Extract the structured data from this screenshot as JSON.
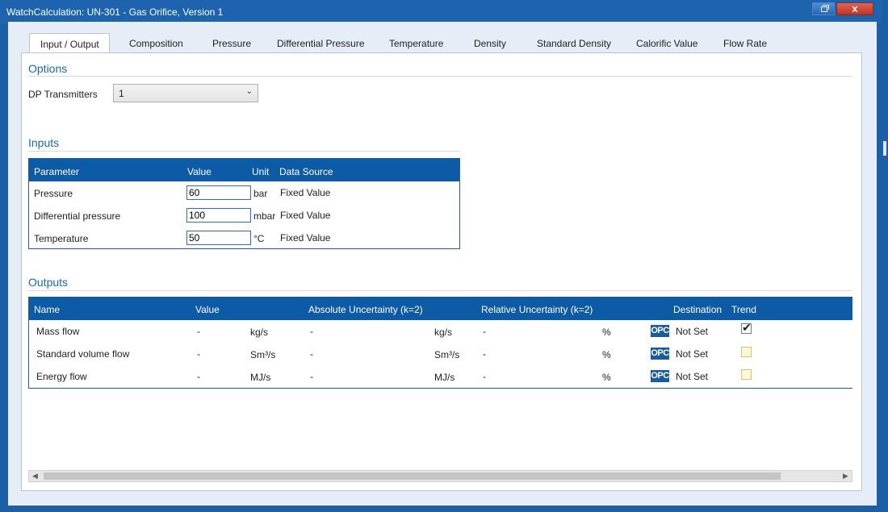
{
  "window": {
    "title": "WatchCalculation: UN-301 - Gas Orifice, Version 1",
    "close_label": "x"
  },
  "tabs": [
    "Input / Output",
    "Composition",
    "Pressure",
    "Differential Pressure",
    "Temperature",
    "Density",
    "Standard Density",
    "Calorific Value",
    "Flow Rate"
  ],
  "active_tab": "Input / Output",
  "options": {
    "title": "Options",
    "dp_label": "DP Transmitters",
    "dp_value": "1"
  },
  "inputs": {
    "title": "Inputs",
    "headers": {
      "parameter": "Parameter",
      "value": "Value",
      "unit": "Unit",
      "source": "Data Source"
    },
    "rows": [
      {
        "parameter": "Pressure",
        "value": "60",
        "unit": "bar",
        "source": "Fixed Value"
      },
      {
        "parameter": "Differential pressure",
        "value": "100",
        "unit": "mbar",
        "source": "Fixed Value"
      },
      {
        "parameter": "Temperature",
        "value": "50",
        "unit": "°C",
        "source": "Fixed Value"
      }
    ]
  },
  "outputs": {
    "title": "Outputs",
    "headers": {
      "name": "Name",
      "value": "Value",
      "abs": "Absolute Uncertainty (k=2)",
      "rel": "Relative Uncertainty (k=2)",
      "dest": "Destination",
      "trend": "Trend"
    },
    "rows": [
      {
        "name": "Mass flow",
        "value": "-",
        "unit": "kg/s",
        "abs": "-",
        "abs_unit": "kg/s",
        "rel": "-",
        "rel_unit": "%",
        "opc": "OPC",
        "dest": "Not Set",
        "trend": true
      },
      {
        "name": "Standard volume flow",
        "value": "-",
        "unit": "Sm³/s",
        "abs": "-",
        "abs_unit": "Sm³/s",
        "rel": "-",
        "rel_unit": "%",
        "opc": "OPC",
        "dest": "Not Set",
        "trend": false
      },
      {
        "name": "Energy flow",
        "value": "-",
        "unit": "MJ/s",
        "abs": "-",
        "abs_unit": "MJ/s",
        "rel": "-",
        "rel_unit": "%",
        "opc": "OPC",
        "dest": "Not Set",
        "trend": false
      }
    ]
  },
  "colors": {
    "accent": "#1c5fa6",
    "header": "#0d5aa7",
    "section_title": "#1b6aa8"
  }
}
